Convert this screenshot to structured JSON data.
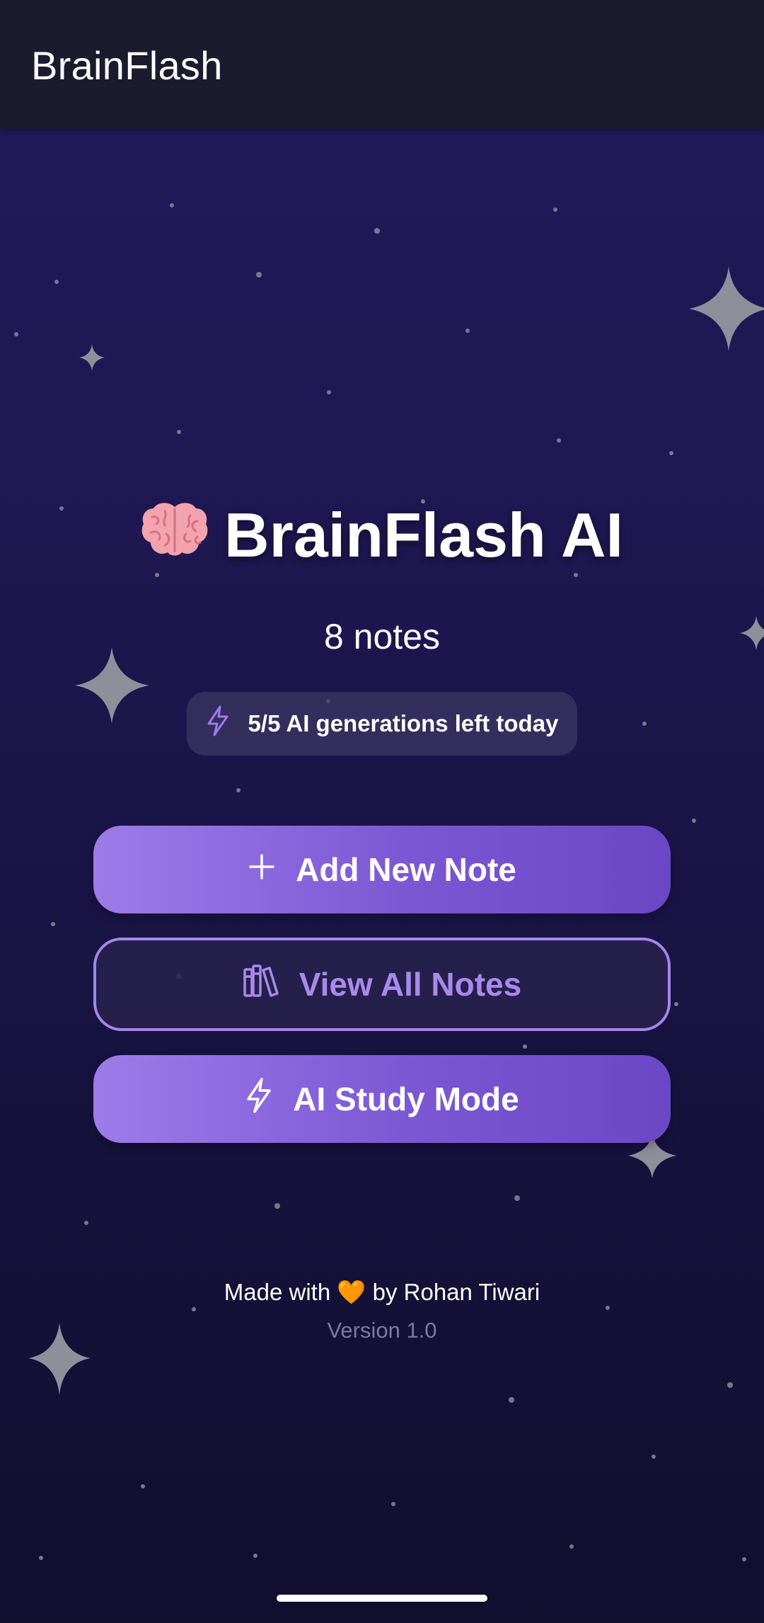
{
  "appbar": {
    "title": "BrainFlash"
  },
  "hero": {
    "emoji": "🧠",
    "title": "BrainFlash AI",
    "brain_icon": "brain-emoji"
  },
  "stats": {
    "notes_count": "8 notes"
  },
  "generations": {
    "icon": "lightning-icon",
    "text": "5/5 AI generations left today"
  },
  "actions": {
    "add_note": {
      "icon": "plus-icon",
      "label": "Add New Note"
    },
    "view_notes": {
      "icon": "books-icon",
      "label": "View All Notes"
    },
    "study_mode": {
      "icon": "lightning-icon",
      "label": "AI Study Mode"
    }
  },
  "footer": {
    "made_prefix": "Made with",
    "heart": "🧡",
    "made_suffix": "by Rohan Tiwari",
    "version": "Version 1.0"
  },
  "colors": {
    "accent": "#8b67dd",
    "appbar_bg": "#1c1b2e",
    "background_top": "#231a5c",
    "background_bottom": "#110e2e",
    "outline": "#a585ea"
  }
}
